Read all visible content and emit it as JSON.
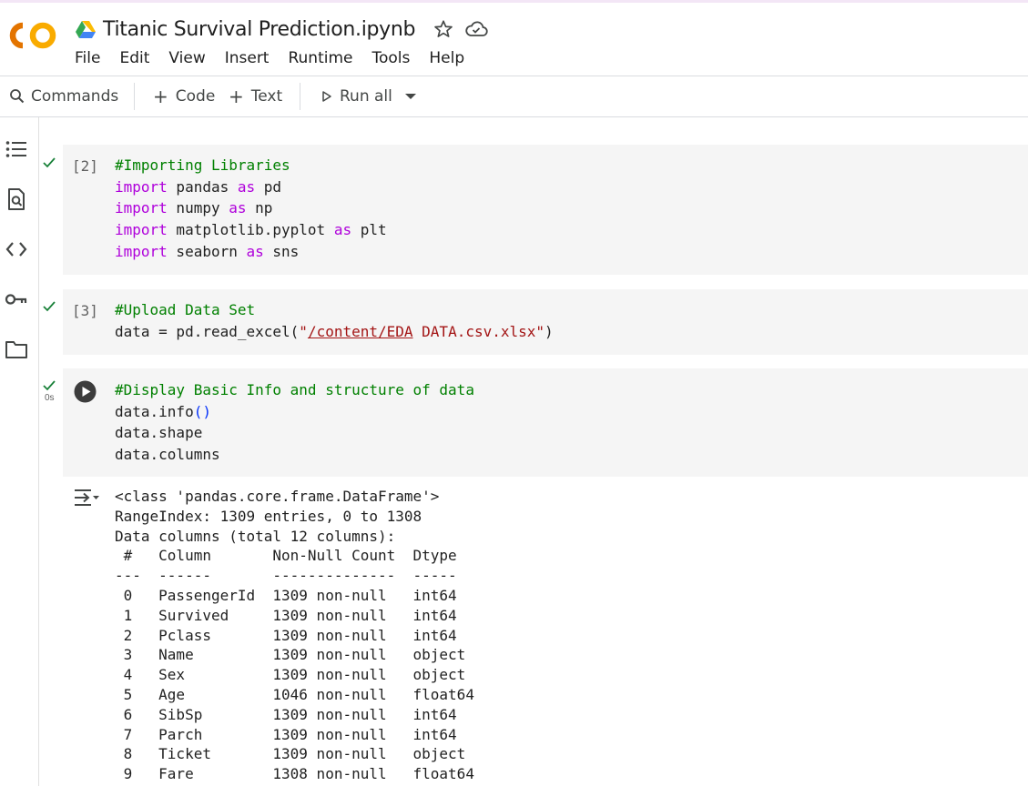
{
  "header": {
    "notebook_title": "Titanic Survival Prediction.ipynb",
    "logo_text": "CO",
    "menu": [
      "File",
      "Edit",
      "View",
      "Insert",
      "Runtime",
      "Tools",
      "Help"
    ]
  },
  "toolbar": {
    "commands_label": "Commands",
    "code_label": "Code",
    "text_label": "Text",
    "run_all_label": "Run all"
  },
  "colors": {
    "logo_orange": "#f9ab00",
    "logo_dark_orange": "#e37400",
    "keyword": "#af00db",
    "comment": "#008000",
    "string": "#a31515",
    "check": "#188038"
  },
  "cells": [
    {
      "exec_count": "[2]",
      "lines": [
        "#Importing Libraries",
        "import pandas as pd",
        "import numpy as np",
        "import matplotlib.pyplot as plt",
        "import seaborn as sns"
      ]
    },
    {
      "exec_count": "[3]",
      "lines": [
        "#Upload Data Set",
        "data = pd.read_excel(\"/content/EDA DATA.csv.xlsx\")"
      ]
    },
    {
      "exec_time": "0s",
      "lines": [
        "#Display Basic Info and structure of data",
        "data.info()",
        "data.shape",
        "data.columns"
      ]
    }
  ],
  "output": {
    "lines": [
      "<class 'pandas.core.frame.DataFrame'>",
      "RangeIndex: 1309 entries, 0 to 1308",
      "Data columns (total 12 columns):",
      " #   Column       Non-Null Count  Dtype ",
      "---  ------       --------------  ----- ",
      " 0   PassengerId  1309 non-null   int64 ",
      " 1   Survived     1309 non-null   int64 ",
      " 2   Pclass       1309 non-null   int64 ",
      " 3   Name         1309 non-null   object",
      " 4   Sex          1309 non-null   object",
      " 5   Age          1046 non-null   float64",
      " 6   SibSp        1309 non-null   int64 ",
      " 7   Parch        1309 non-null   int64 ",
      " 8   Ticket       1309 non-null   object",
      " 9   Fare         1308 non-null   float64"
    ]
  }
}
